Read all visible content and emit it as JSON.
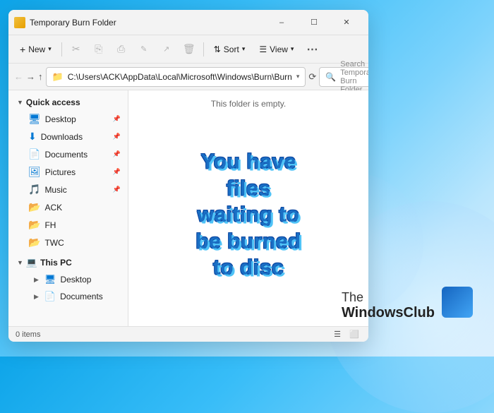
{
  "window": {
    "title": "Temporary Burn Folder",
    "address": "C:\\Users\\ACK\\AppData\\Local\\Microsoft\\Windows\\Burn\\Burn",
    "search_placeholder": "Search Temporary Burn Folder",
    "empty_message": "This folder is empty.",
    "status": "0 items",
    "burn_line1": "You have files",
    "burn_line2": "waiting to be burned",
    "burn_line3": "to disc"
  },
  "toolbar": {
    "new_label": "New",
    "sort_label": "Sort",
    "view_label": "View"
  },
  "sidebar": {
    "quick_access_label": "Quick access",
    "items": [
      {
        "label": "Desktop",
        "icon": "desktop"
      },
      {
        "label": "Downloads",
        "icon": "downloads"
      },
      {
        "label": "Documents",
        "icon": "documents"
      },
      {
        "label": "Pictures",
        "icon": "pictures"
      },
      {
        "label": "Music",
        "icon": "music"
      }
    ],
    "folders": [
      {
        "label": "ACK",
        "icon": "folder-yellow"
      },
      {
        "label": "FH",
        "icon": "folder-yellow"
      },
      {
        "label": "TWC",
        "icon": "folder-yellow"
      }
    ],
    "this_pc_label": "This PC",
    "pc_items": [
      {
        "label": "Desktop",
        "icon": "desktop"
      },
      {
        "label": "Documents",
        "icon": "documents"
      }
    ]
  },
  "watermark": {
    "the": "The",
    "name": "WindowsClub"
  }
}
